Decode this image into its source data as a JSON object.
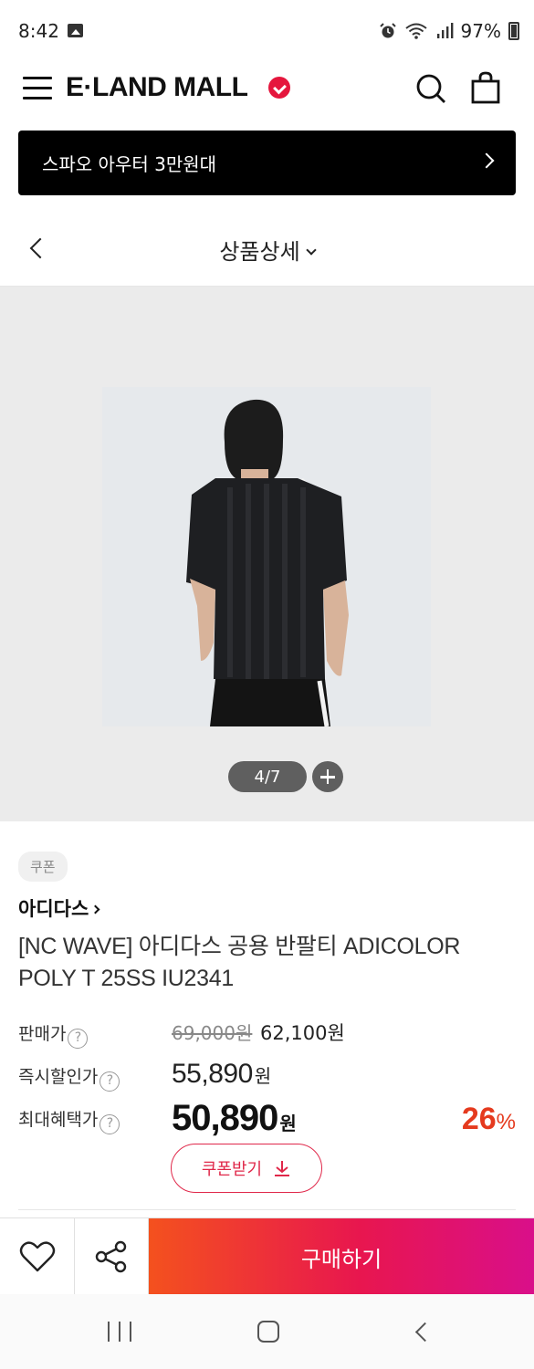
{
  "status_bar": {
    "time": "8:42",
    "battery": "97%",
    "icons": [
      "gallery-icon",
      "alarm-icon",
      "wifi-icon",
      "signal-icon",
      "battery-icon"
    ]
  },
  "header": {
    "logo": "E·LAND MALL",
    "icons": [
      "menu-icon",
      "search-icon",
      "shopping-bag-icon"
    ],
    "brand_color": "#e5163d"
  },
  "banner": {
    "text": "스파오 아우터 3만원대"
  },
  "page": {
    "title": "상품상세"
  },
  "gallery": {
    "current": "4",
    "total": "7",
    "indicator": "4/7"
  },
  "product": {
    "coupon_tag": "쿠폰",
    "brand": "아디다스",
    "name_line1": "[NC WAVE] 아디다스 공용 반팔티 ADICOLOR",
    "name_line2": "POLY T 25SS IU2341"
  },
  "pricing": {
    "sale_label": "판매가",
    "original_price": "69,000원",
    "sale_price": "62,100원",
    "instant_label": "즉시할인가",
    "instant_price": "55,890",
    "instant_unit": "원",
    "max_label": "최대혜택가",
    "max_price": "50,890",
    "max_unit": "원",
    "discount_number": "26",
    "discount_percent_sign": "%",
    "coupon_button": "쿠폰받기",
    "accent_color": "#e53a1e"
  },
  "actions": {
    "buy_label": "구매하기"
  }
}
